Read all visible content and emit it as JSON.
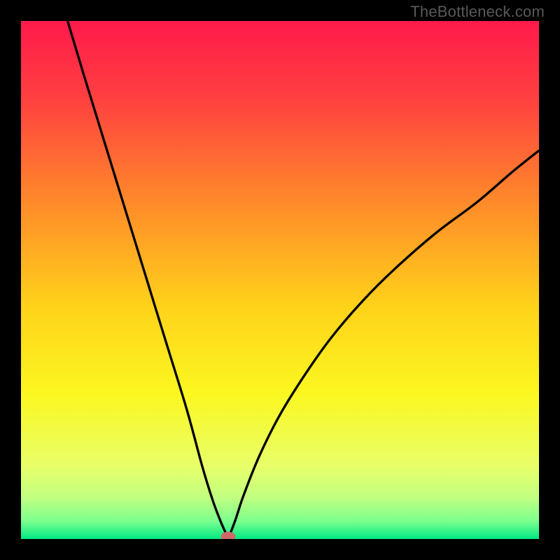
{
  "watermark": "TheBottleneck.com",
  "colors": {
    "frame": "#000000",
    "curve": "#000000",
    "marker_fill": "#cf6766",
    "gradient_stops": [
      {
        "offset": 0.0,
        "color": "#ff1a4b"
      },
      {
        "offset": 0.15,
        "color": "#ff4040"
      },
      {
        "offset": 0.35,
        "color": "#ff8a2a"
      },
      {
        "offset": 0.55,
        "color": "#ffd21a"
      },
      {
        "offset": 0.72,
        "color": "#fbf720"
      },
      {
        "offset": 0.86,
        "color": "#e8ff6a"
      },
      {
        "offset": 0.92,
        "color": "#c1ff80"
      },
      {
        "offset": 0.965,
        "color": "#7dff8e"
      },
      {
        "offset": 1.0,
        "color": "#00e884"
      }
    ]
  },
  "chart_data": {
    "type": "line",
    "title": "",
    "xlabel": "",
    "ylabel": "",
    "xlim": [
      0,
      100
    ],
    "ylim": [
      0,
      100
    ],
    "min_point": {
      "x": 40,
      "y": 0
    },
    "left_branch_top": {
      "x": 9,
      "y": 100
    },
    "right_branch_top": {
      "x": 100,
      "y": 75
    },
    "series": [
      {
        "name": "bottleneck-curve",
        "x": [
          9,
          12,
          16,
          20,
          24,
          28,
          32,
          35,
          37,
          38.5,
          39.5,
          40,
          40.5,
          41.5,
          43,
          46,
          50,
          55,
          60,
          66,
          72,
          80,
          88,
          95,
          100
        ],
        "y": [
          100,
          90,
          77,
          64,
          51,
          38,
          25,
          14,
          7.5,
          3.5,
          1.2,
          0,
          1.3,
          4,
          8.5,
          16,
          24,
          32,
          39,
          46,
          52,
          59,
          65,
          71,
          75
        ]
      }
    ],
    "marker": {
      "x": 40,
      "y": 0,
      "rx": 1.4,
      "ry": 0.9
    }
  }
}
